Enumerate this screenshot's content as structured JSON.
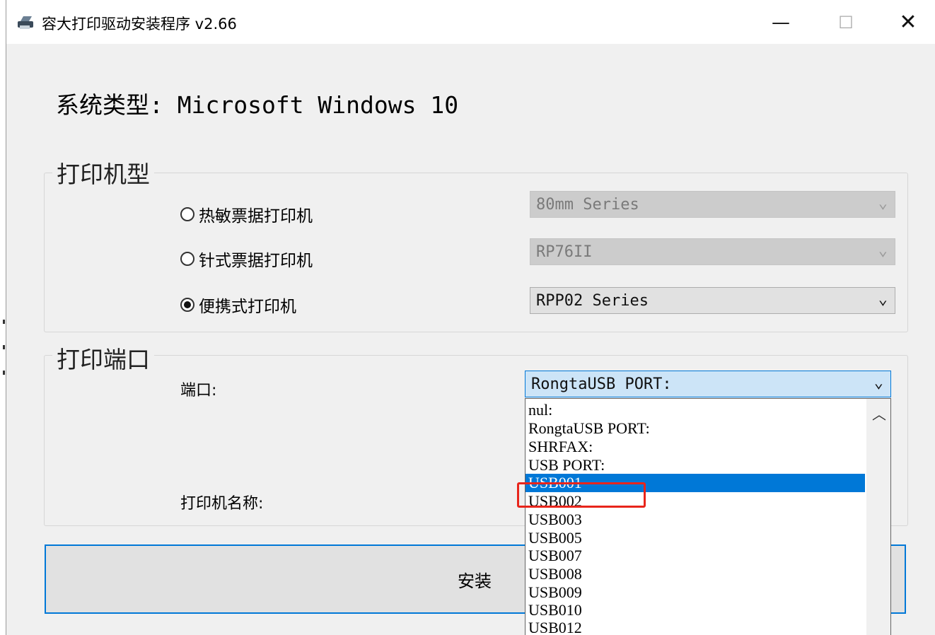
{
  "window": {
    "title": "容大打印驱动安装程序 v2.66",
    "controls": {
      "minimize": "—",
      "maximize": "☐",
      "close": "✕"
    }
  },
  "system_type": "系统类型: Microsoft Windows 10",
  "printer_model": {
    "group_title": "打印机型",
    "options": [
      {
        "label": "热敏票据打印机",
        "selected": false,
        "combo_value": "80mm Series",
        "combo_enabled": false
      },
      {
        "label": "针式票据打印机",
        "selected": false,
        "combo_value": "RP76II",
        "combo_enabled": false
      },
      {
        "label": "便携式打印机",
        "selected": true,
        "combo_value": "RPP02 Series",
        "combo_enabled": true
      }
    ]
  },
  "printer_port": {
    "group_title": "打印端口",
    "port_label": "端口:",
    "port_value": "RongtaUSB PORT:",
    "printer_name_label": "打印机名称:",
    "dropdown_options": [
      "nul:",
      "RongtaUSB PORT:",
      "SHRFAX:",
      "USB PORT:",
      "USB001",
      "USB002",
      "USB003",
      "USB005",
      "USB007",
      "USB008",
      "USB009",
      "USB010",
      "USB012"
    ],
    "dropdown_selected": "USB001",
    "highlighted_option": "USB002"
  },
  "install_button": {
    "label": "安装"
  },
  "colors": {
    "accent": "#0078d7",
    "highlight_box": "#e8251b",
    "window_bg": "#f0f0f0"
  }
}
